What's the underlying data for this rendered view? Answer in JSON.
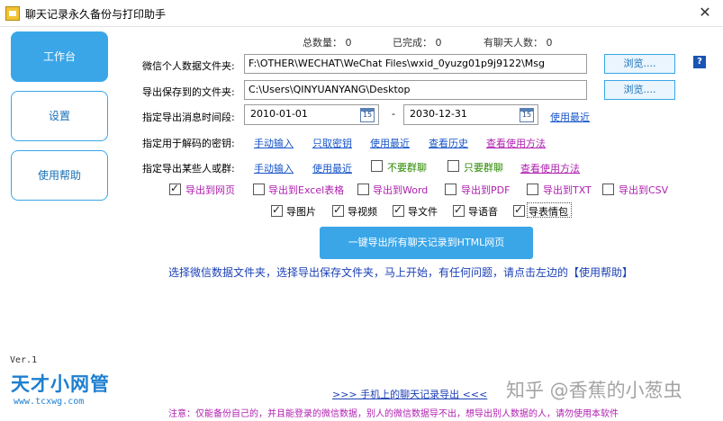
{
  "window": {
    "title": "聊天记录永久备份与打印助手",
    "close_glyph": "✕"
  },
  "sidebar": {
    "items": [
      {
        "label": "工作台",
        "active": true
      },
      {
        "label": "设置",
        "active": false
      },
      {
        "label": "使用帮助",
        "active": false
      }
    ],
    "version": "Ver.1",
    "logo_text": "天才小网管",
    "logo_url": "www.tcxwg.com"
  },
  "stats": {
    "total_label": "总数量：",
    "total_value": "0",
    "done_label": "已完成：",
    "done_value": "0",
    "contacts_label": "有聊天人数：",
    "contacts_value": "0"
  },
  "folder": {
    "label": "微信个人数据文件夹:",
    "value": "F:\\OTHER\\WECHAT\\WeChat Files\\wxid_0yuzg01p9j9122\\Msg",
    "browse_label": "浏览....",
    "help_label": "?"
  },
  "save": {
    "label": "导出保存到的文件夹:",
    "value": "C:\\Users\\QINYUANYANG\\Desktop",
    "browse_label": "浏览...."
  },
  "period": {
    "label": "指定导出消息时间段:",
    "start": "2010-01-01",
    "sep": "-",
    "end": "2030-12-31",
    "calendar_icon": "15",
    "recent_link": "使用最近"
  },
  "key": {
    "label": "指定用于解码的密钥:",
    "links": [
      "手动输入",
      "只取密钥",
      "使用最近",
      "查看历史",
      "查看使用方法"
    ]
  },
  "people": {
    "label": "指定导出某些人或群:",
    "links": [
      "手动输入",
      "使用最近"
    ],
    "no_group": "不要群聊",
    "only_group": "只要群聊",
    "method_link": "查看使用方法"
  },
  "formats": [
    {
      "label": "导出到网页",
      "checked": true
    },
    {
      "label": "导出到Excel表格",
      "checked": false
    },
    {
      "label": "导出到Word",
      "checked": false
    },
    {
      "label": "导出到PDF",
      "checked": false
    },
    {
      "label": "导出到TXT",
      "checked": false
    },
    {
      "label": "导出到CSV",
      "checked": false
    }
  ],
  "media": [
    {
      "label": "导图片",
      "checked": true
    },
    {
      "label": "导视频",
      "checked": true
    },
    {
      "label": "导文件",
      "checked": true
    },
    {
      "label": "导语音",
      "checked": true
    },
    {
      "label": "导表情包",
      "checked": true
    }
  ],
  "export_button": "一键导出所有聊天记录到HTML网页",
  "instruction": "选择微信数据文件夹，选择导出保存文件夹，马上开始，有任何问题，请点击左边的【使用帮助】",
  "phone_link": ">>>  手机上的聊天记录导出  <<<",
  "notice": "注意：仅能备份自己的，并且能登录的微信数据，别人的微信数据导不出，想导出别人数据的人，请勿使用本软件",
  "watermark": "知乎 @香蕉的小葱虫",
  "colors": {
    "accent": "#3aa6e8",
    "link": "#1654c8",
    "magenta": "#b020b0",
    "green": "#2b8a00"
  }
}
